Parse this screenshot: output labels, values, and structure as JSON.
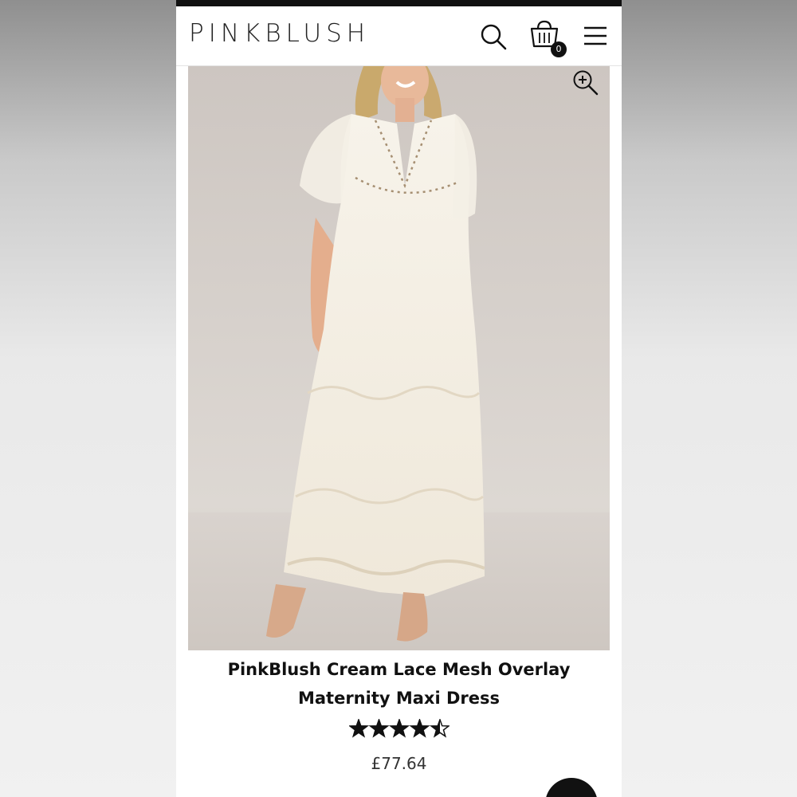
{
  "brand": {
    "logo_text": "PINKBLUSH"
  },
  "header": {
    "icons": [
      "search-icon",
      "shopping-bag-icon",
      "hamburger-menu-icon"
    ],
    "cart_count": "0"
  },
  "product": {
    "image_icon": "zoom-in-icon",
    "title_line1": "PinkBlush Cream Lace Mesh Overlay",
    "title_line2": "Maternity Maxi Dress",
    "rating": 4.5,
    "rating_max": 5,
    "price": "£77.64"
  },
  "colors": {
    "header_bg": "#ffffff",
    "text": "#111111",
    "badge_bg": "#111111",
    "dress": "#f4efe3",
    "backdrop": "#d6d0cb"
  }
}
